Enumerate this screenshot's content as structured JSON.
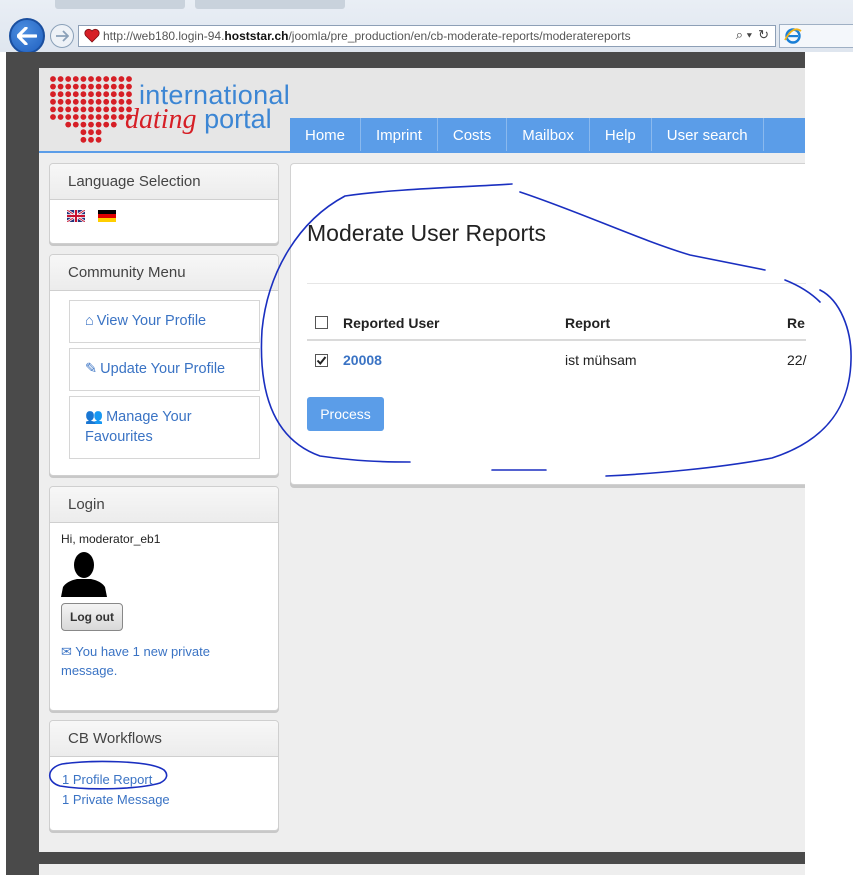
{
  "browser": {
    "url_prefix": "http://web180.login-94.",
    "url_host": "hoststar.ch",
    "url_path": "/joomla/pre_production/en/cb-moderate-reports/moderatereports",
    "search_glyph": "⌕ ▾",
    "refresh_glyph": "↻",
    "back_icon": "back-arrow-icon",
    "forward_icon": "forward-arrow-icon"
  },
  "header": {
    "logo_line1": "international",
    "logo_dating": "dating",
    "logo_portal": "portal",
    "heart_color": "#d61f26",
    "brand_color": "#3c86d4"
  },
  "nav": {
    "items": [
      "Home",
      "Imprint",
      "Costs",
      "Mailbox",
      "Help",
      "User search"
    ]
  },
  "sidebar": {
    "language": {
      "title": "Language Selection",
      "flags": [
        "uk-flag-icon",
        "germany-flag-icon"
      ]
    },
    "community": {
      "title": "Community Menu",
      "items": [
        {
          "icon": "⌂",
          "label": "View Your Profile"
        },
        {
          "icon": "✎",
          "label": "Update Your Profile"
        },
        {
          "icon": "👥",
          "label": "Manage Your Favourites"
        }
      ]
    },
    "login": {
      "title": "Login",
      "greeting": "Hi, moderator_eb1",
      "logout_label": "Log out",
      "pm_icon": "✉",
      "pm_text": "You have 1 new private message."
    },
    "workflows": {
      "title": "CB Workflows",
      "links": [
        "1 Profile Report",
        "1 Private Message"
      ]
    }
  },
  "content": {
    "title": "Moderate User Reports",
    "table": {
      "headers": [
        "Reported User",
        "Report",
        "Re"
      ],
      "rows": [
        {
          "checked": true,
          "user": "20008",
          "report": "ist mühsam",
          "date": "22/"
        }
      ]
    },
    "process_label": "Process"
  },
  "colors": {
    "nav_blue": "#5b9de8",
    "link_blue": "#3a73c4",
    "annotation_ink": "#1a2fc0"
  }
}
